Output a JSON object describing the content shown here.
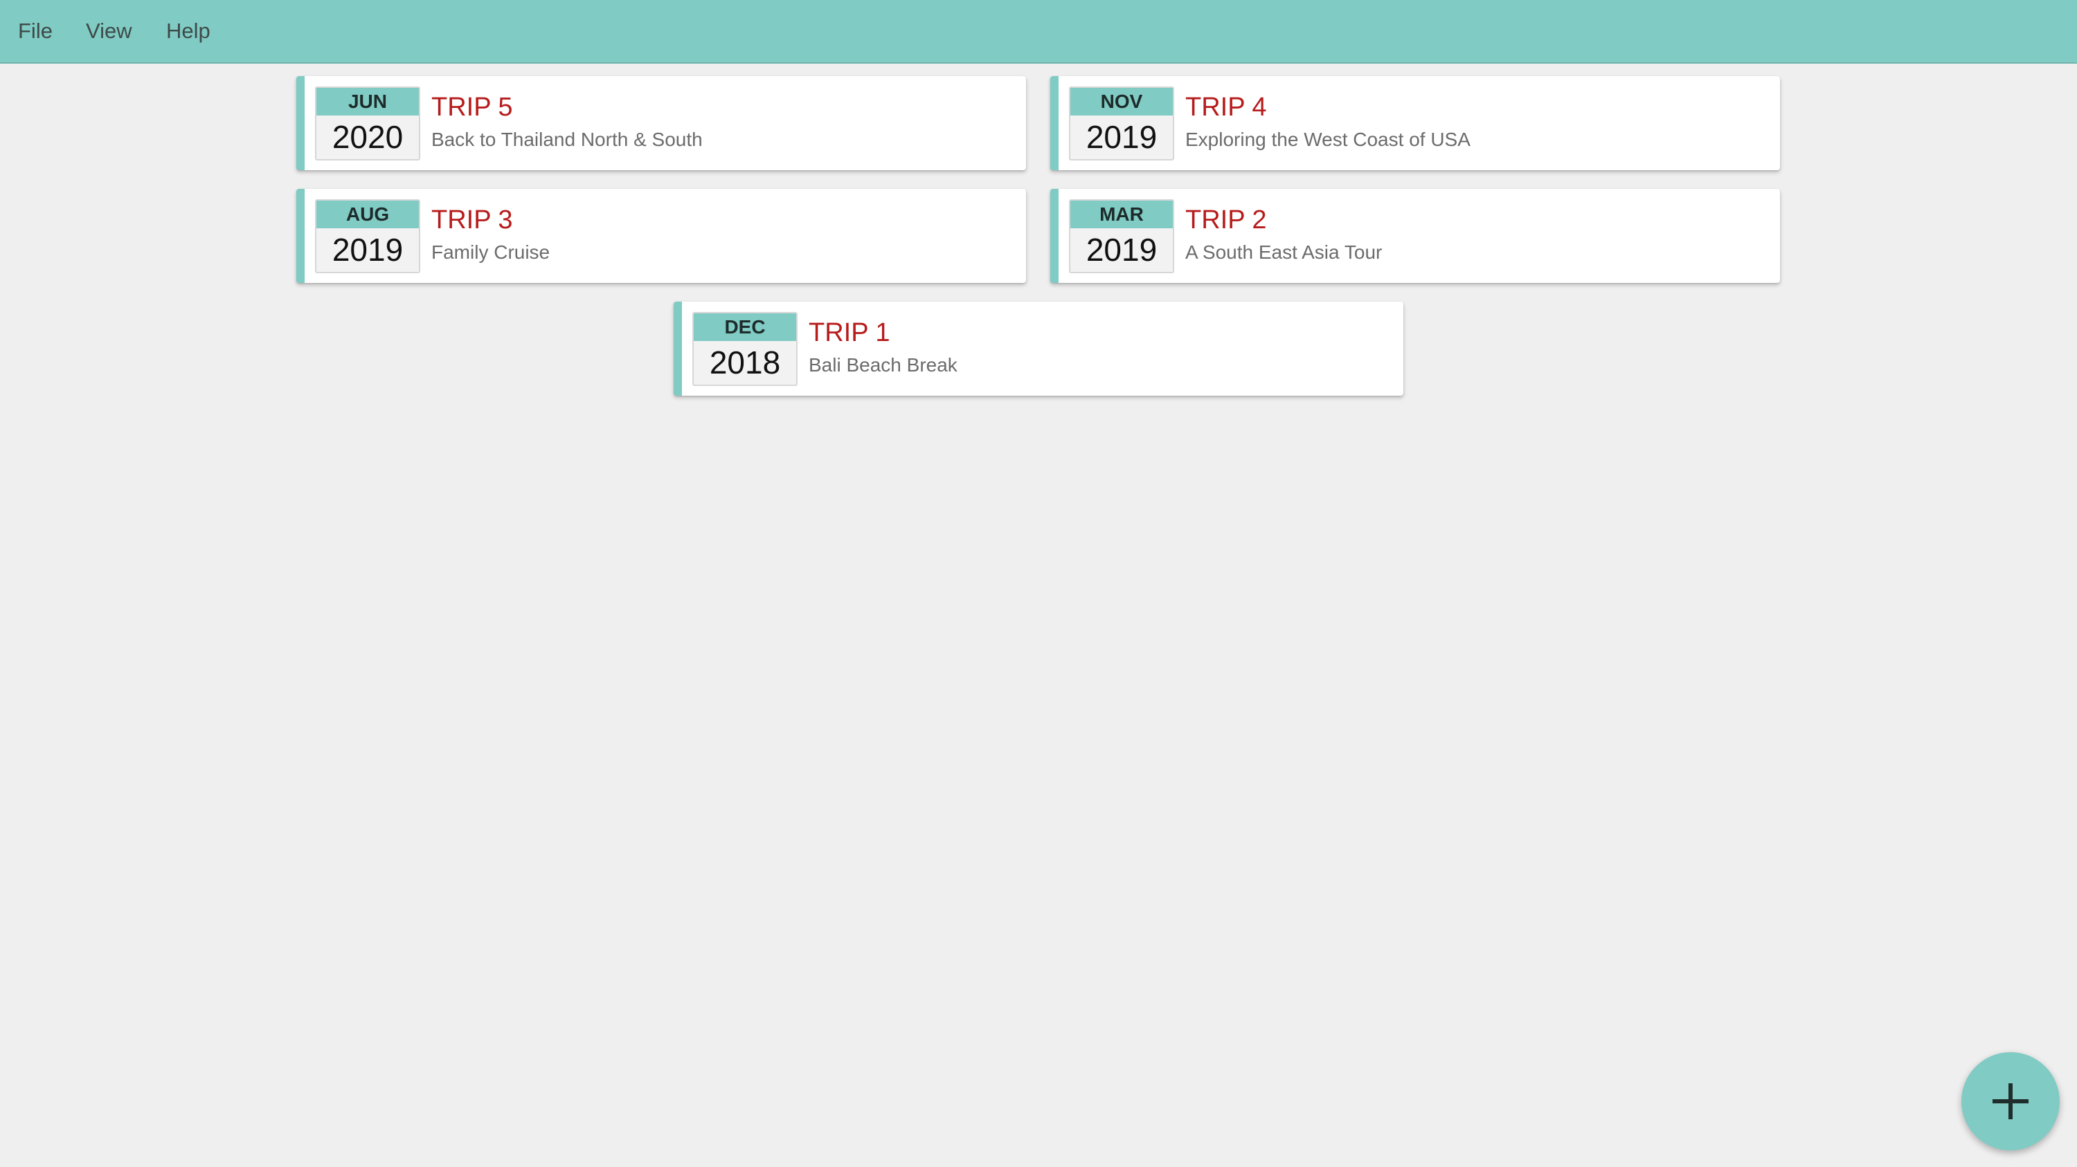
{
  "menu": {
    "file": "File",
    "view": "View",
    "help": "Help"
  },
  "colors": {
    "accent": "#80cbc4",
    "title": "#b71c1c",
    "background": "#efefef"
  },
  "trips": [
    {
      "month": "JUN",
      "year": "2020",
      "title": "TRIP 5",
      "subtitle": "Back to Thailand North & South"
    },
    {
      "month": "NOV",
      "year": "2019",
      "title": "TRIP 4",
      "subtitle": "Exploring the West Coast of USA"
    },
    {
      "month": "AUG",
      "year": "2019",
      "title": "TRIP 3",
      "subtitle": "Family Cruise"
    },
    {
      "month": "MAR",
      "year": "2019",
      "title": "TRIP 2",
      "subtitle": "A South East Asia Tour"
    },
    {
      "month": "DEC",
      "year": "2018",
      "title": "TRIP 1",
      "subtitle": "Bali Beach Break"
    }
  ],
  "fab": {
    "icon": "plus-icon"
  }
}
